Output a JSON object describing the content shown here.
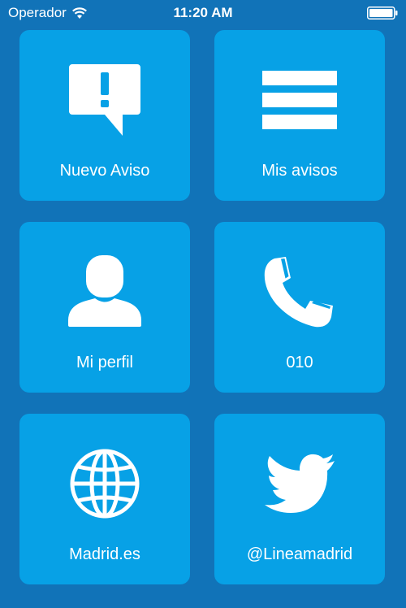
{
  "status_bar": {
    "carrier": "Operador",
    "time": "11:20 AM"
  },
  "tiles": [
    {
      "label": "Nuevo Aviso",
      "icon": "alert-speech-bubble-icon"
    },
    {
      "label": "Mis avisos",
      "icon": "list-icon"
    },
    {
      "label": "Mi perfil",
      "icon": "user-icon"
    },
    {
      "label": "010",
      "icon": "phone-icon"
    },
    {
      "label": "Madrid.es",
      "icon": "globe-icon"
    },
    {
      "label": "@Lineamadrid",
      "icon": "twitter-bird-icon"
    }
  ],
  "colors": {
    "background": "#1173b8",
    "tile": "#07a1e6",
    "foreground": "#ffffff"
  }
}
